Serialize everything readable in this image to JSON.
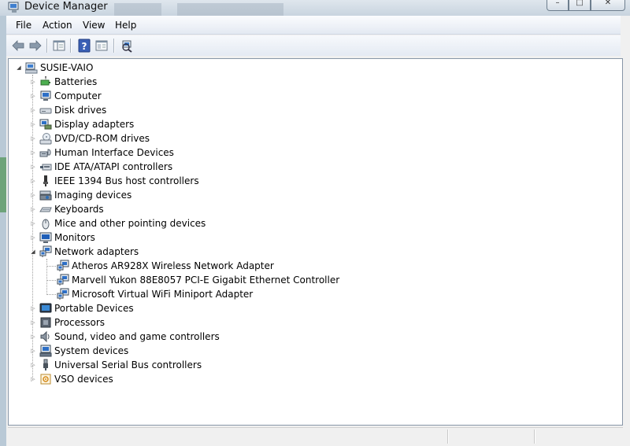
{
  "window": {
    "title": "Device Manager",
    "controls": {
      "minimize": "–",
      "maximize": "□",
      "close": "✕"
    }
  },
  "menu": {
    "items": [
      {
        "label": "File"
      },
      {
        "label": "Action"
      },
      {
        "label": "View"
      },
      {
        "label": "Help"
      }
    ]
  },
  "toolbar": {
    "buttons": [
      "back-arrow-icon",
      "forward-arrow-icon",
      "show-hide-console-tree-icon",
      "help-icon",
      "properties-icon",
      "scan-hardware-icon"
    ]
  },
  "tree": {
    "root": {
      "label": "SUSIE-VAIO",
      "expanded": true,
      "icon": "computer-icon"
    },
    "categories": [
      {
        "label": "Batteries",
        "icon": "battery-icon"
      },
      {
        "label": "Computer",
        "icon": "monitor-icon"
      },
      {
        "label": "Disk drives",
        "icon": "disk-drive-icon"
      },
      {
        "label": "Display adapters",
        "icon": "display-adapter-icon"
      },
      {
        "label": "DVD/CD-ROM drives",
        "icon": "dvd-drive-icon"
      },
      {
        "label": "Human Interface Devices",
        "icon": "hid-icon"
      },
      {
        "label": "IDE ATA/ATAPI controllers",
        "icon": "ide-controller-icon"
      },
      {
        "label": "IEEE 1394 Bus host controllers",
        "icon": "firewire-icon"
      },
      {
        "label": "Imaging devices",
        "icon": "camera-icon"
      },
      {
        "label": "Keyboards",
        "icon": "keyboard-icon"
      },
      {
        "label": "Mice and other pointing devices",
        "icon": "mouse-icon"
      },
      {
        "label": "Monitors",
        "icon": "monitor-icon"
      },
      {
        "label": "Network adapters",
        "icon": "network-adapter-icon",
        "expanded": true,
        "children": [
          {
            "label": "Atheros AR928X Wireless Network Adapter"
          },
          {
            "label": "Marvell Yukon 88E8057 PCI-E Gigabit Ethernet Controller"
          },
          {
            "label": "Microsoft Virtual WiFi Miniport Adapter"
          }
        ]
      },
      {
        "label": "Portable Devices",
        "icon": "portable-device-icon"
      },
      {
        "label": "Processors",
        "icon": "processor-icon"
      },
      {
        "label": "Sound, video and game controllers",
        "icon": "speaker-icon"
      },
      {
        "label": "System devices",
        "icon": "system-device-icon"
      },
      {
        "label": "Universal Serial Bus controllers",
        "icon": "usb-icon"
      },
      {
        "label": "VSO devices",
        "icon": "vso-device-icon"
      }
    ]
  },
  "colors": {
    "titlebar": "#d3dde7",
    "tree_bg": "#ffffff",
    "border": "#8796a7"
  }
}
